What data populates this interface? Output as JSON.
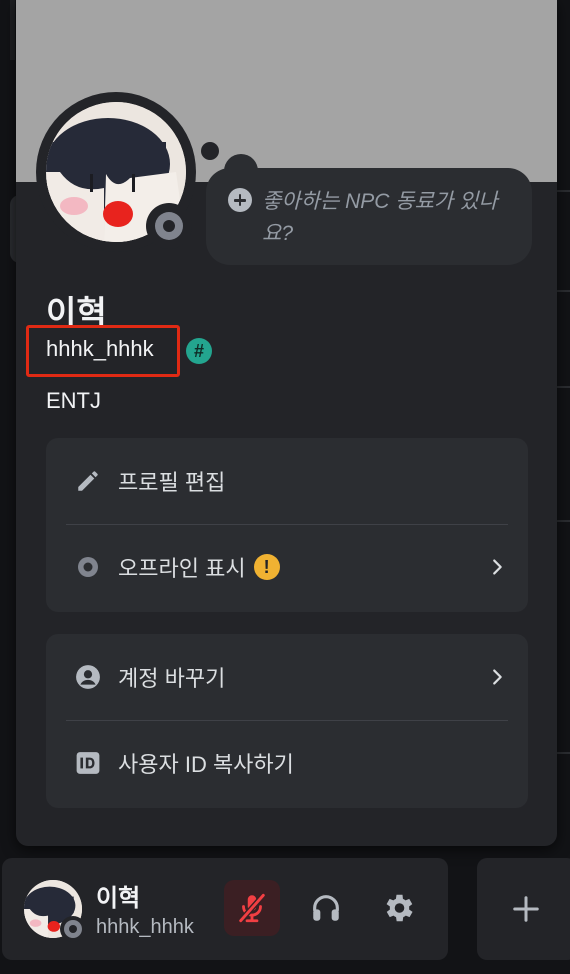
{
  "profile": {
    "display_name": "이혁",
    "username": "hhhk_hhhk",
    "badge_symbol": "#",
    "bio": "ENTJ",
    "status_bubble": "좋아하는 NPC 동료가 있나요?",
    "status": "offline"
  },
  "menu_primary": {
    "edit_profile": "프로필 편집",
    "show_offline": "오프라인 표시",
    "warning_symbol": "!"
  },
  "menu_secondary": {
    "switch_accounts": "계정 바꾸기",
    "copy_user_id": "사용자 ID 복사하기"
  },
  "userbar": {
    "display_name": "이혁",
    "username": "hhhk_hhhk",
    "mic_state": "muted"
  },
  "colors": {
    "banner": "#a4a4a4",
    "highlight_box": "#e02a14",
    "badge": "#23a58f",
    "warning": "#f0b232",
    "mic_muted": "#f23f43"
  },
  "icons": {
    "edit": "pencil-icon",
    "offline": "offline-status-icon",
    "switch": "account-circle-icon",
    "copy_id": "id-card-icon",
    "bubble_add": "plus-circle-icon"
  }
}
